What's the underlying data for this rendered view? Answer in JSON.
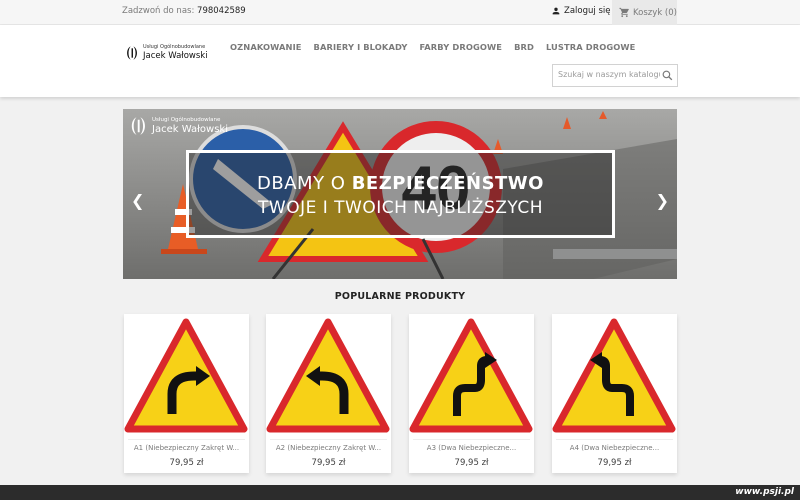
{
  "topbar": {
    "contact_label": "Zadzwoń do nas:",
    "phone": "798042589",
    "login_label": "Zaloguj się",
    "cart_label": "Koszyk (0)"
  },
  "logo": {
    "line1": "Usługi Ogólnobudowlane",
    "line2": "Jacek Wałowski"
  },
  "menu": [
    "OZNAKOWANIE",
    "BARIERY I BLOKADY",
    "FARBY DROGOWE",
    "BRD",
    "LUSTRA DROGOWE"
  ],
  "search": {
    "placeholder": "Szukaj w naszym katalogu"
  },
  "banner": {
    "brand_line1": "Usługi Ogólnobudowlane",
    "brand_line2": "Jacek Wałowski",
    "headline_pre": "DBAMY O ",
    "headline_bold": "BEZPIECZEŃSTWO",
    "headline_line2": "TWOJE I TWOICH NAJBLIŻSZYCH",
    "sign_number": "40"
  },
  "section_title": "POPULARNE PRODUKTY",
  "products": [
    {
      "name": "A1 (Niebezpieczny Zakręt W...",
      "price": "79,95 zł",
      "icon": "curve-right-sign"
    },
    {
      "name": "A2 (Niebezpieczny Zakręt W...",
      "price": "79,95 zł",
      "icon": "curve-left-sign"
    },
    {
      "name": "A3 (Dwa Niebezpieczne...",
      "price": "79,95 zł",
      "icon": "double-curve-right-sign"
    },
    {
      "name": "A4 (Dwa Niebezpieczne...",
      "price": "79,95 zł",
      "icon": "double-curve-left-sign"
    }
  ],
  "watermark": "www.psji.pl",
  "colors": {
    "sign_yellow": "#f7d117",
    "sign_red": "#d9282c",
    "menu_text": "#7a7a7a"
  }
}
